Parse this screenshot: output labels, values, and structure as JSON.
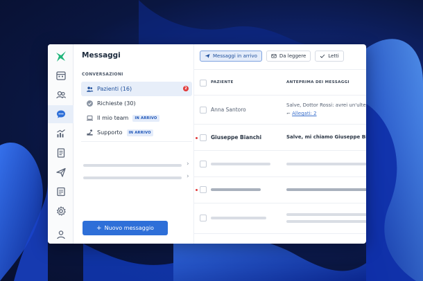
{
  "app": {
    "title": "Messaggi",
    "accent": "#2e6fd8"
  },
  "rail": {
    "icons": [
      "calendar-icon",
      "patients-icon",
      "chat-icon",
      "stats-icon",
      "document-icon",
      "send-icon",
      "notes-icon",
      "settings-icon",
      "profile-icon"
    ],
    "active": "chat-icon"
  },
  "sidebar": {
    "section_label": "CONVERSAZIONI",
    "items": [
      {
        "label": "Pazienti (16)",
        "icon": "patients-icon",
        "count": "2"
      },
      {
        "label": "Richieste (30)",
        "icon": "check-circle-icon"
      },
      {
        "label": "Il mio team",
        "icon": "laptop-icon",
        "badge": "IN ARRIVO"
      },
      {
        "label": "Supporto",
        "icon": "support-icon",
        "badge": "IN ARRIVO"
      }
    ],
    "new_message_label": "Nuovo messaggio"
  },
  "toolbar": {
    "filters": [
      {
        "label": "Messaggi in arrivo",
        "icon": "send-icon",
        "active": true
      },
      {
        "label": "Da leggere",
        "icon": "mail-icon",
        "active": false
      },
      {
        "label": "Letti",
        "icon": "check-icon",
        "active": false
      }
    ]
  },
  "table": {
    "columns": [
      "PAZIENTE",
      "ANTEPRIMA DEI MESSAGGI"
    ],
    "rows": [
      {
        "patient": "Anna Santoro",
        "preview": "Salve, Dottor Rossi: avrei un'ulteriore do",
        "attachment_label": "Allegati: 2",
        "unread": false
      },
      {
        "patient": "Giuseppe Bianchi",
        "preview": "Salve, mi chiamo Giuseppe Bianchi e ho",
        "unread": true
      }
    ]
  }
}
